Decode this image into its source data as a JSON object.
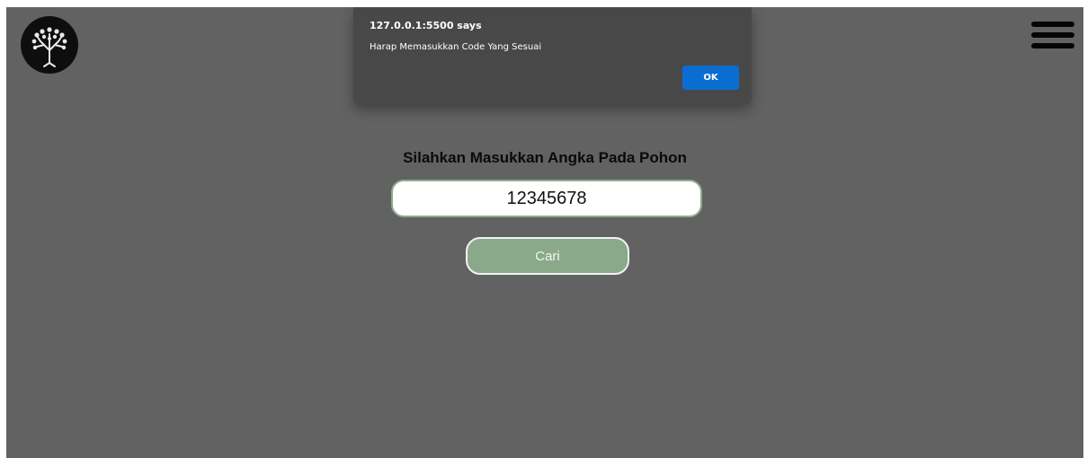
{
  "header": {
    "logo_icon": "tree-icon",
    "menu_icon": "hamburger-menu-icon"
  },
  "alert": {
    "title": "127.0.0.1:5500 says",
    "message": "Harap Memasukkan Code Yang Sesuai",
    "ok_label": "OK"
  },
  "form": {
    "prompt": "Silahkan Masukkan Angka Pada Pohon",
    "code_value": "12345678",
    "search_label": "Cari"
  },
  "colors": {
    "overlay_background": "#626262",
    "dialog_background": "#484848",
    "ok_button": "#0b6dd1",
    "search_button": "#8aa98a"
  }
}
